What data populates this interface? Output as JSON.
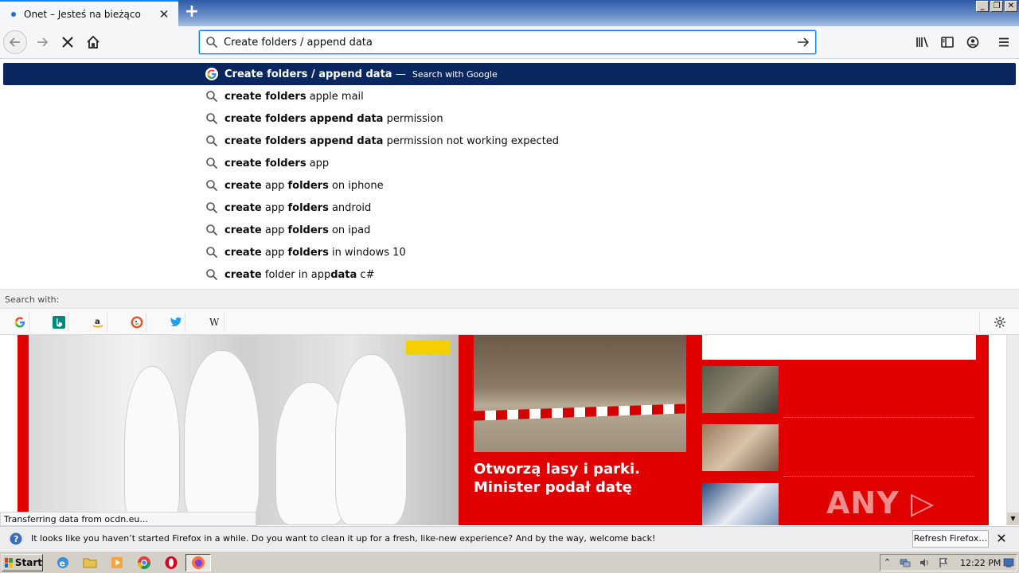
{
  "browser": {
    "tab_title": "Onet – Jesteś na bieżąco",
    "tab_close": "✕",
    "new_tab": "+",
    "window_controls": [
      "_",
      "❐",
      "✕"
    ],
    "url_text": "Create folders / append data"
  },
  "suggestions": {
    "first": {
      "bold": "Create folders / append data",
      "dash": " — ",
      "hint": "Search with Google"
    },
    "items": [
      {
        "bold1": "create folders",
        "rest1": " apple mail",
        "bold2": "",
        "rest2": ""
      },
      {
        "bold1": "create folders append data",
        "rest1": " permission",
        "bold2": "",
        "rest2": ""
      },
      {
        "bold1": "create folders append data",
        "rest1": " permission not working expected",
        "bold2": "",
        "rest2": ""
      },
      {
        "bold1": "create folders",
        "rest1": " app",
        "bold2": "",
        "rest2": ""
      },
      {
        "bold1": "create",
        "rest1": " app ",
        "bold2": "folders",
        "rest2": " on iphone"
      },
      {
        "bold1": "create",
        "rest1": " app ",
        "bold2": "folders",
        "rest2": " android"
      },
      {
        "bold1": "create",
        "rest1": " app ",
        "bold2": "folders",
        "rest2": " on ipad"
      },
      {
        "bold1": "create",
        "rest1": " app ",
        "bold2": "folders",
        "rest2": " in windows 10"
      },
      {
        "bold1": "create",
        "rest1": " folder in app",
        "bold2": "data",
        "rest2": " c#"
      }
    ],
    "search_with_label": "Search with:",
    "engines": [
      "google-icon",
      "bing-icon",
      "amazon-icon",
      "duckduckgo-icon",
      "twitter-icon",
      "wikipedia-icon"
    ]
  },
  "page": {
    "headline": "Otworzą lasy i parki. Minister podał datę",
    "status_text": "Transferring data from ocdn.eu...",
    "watermark": "ANY ▷ RUN"
  },
  "notification": {
    "text": "It looks like you haven’t started Firefox in a while. Do you want to clean it up for a fresh, like-new experience? And by the way, welcome back!",
    "button": "Refresh Firefox…",
    "close": "✕"
  },
  "taskbar": {
    "start_label": "Start",
    "clock": "12:22 PM"
  },
  "colors": {
    "selected_row": "#0a2760",
    "onet_red": "#e10000",
    "focus_blue": "#0a84ff"
  }
}
